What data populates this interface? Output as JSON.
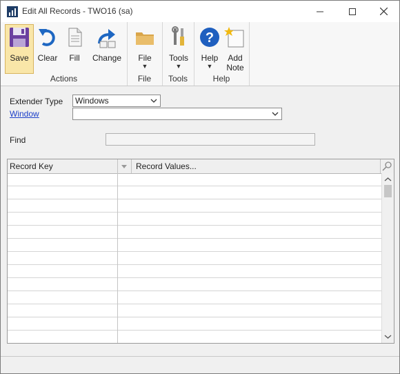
{
  "window": {
    "title": "Edit All Records  -  TWO16 (sa)"
  },
  "ribbon": {
    "groups": {
      "actions": "Actions",
      "file": "File",
      "tools": "Tools",
      "help": "Help"
    },
    "buttons": {
      "save": "Save",
      "clear": "Clear",
      "fill": "Fill",
      "change": "Change",
      "file": "File",
      "tools": "Tools",
      "help": "Help",
      "add_note_1": "Add",
      "add_note_2": "Note"
    }
  },
  "form": {
    "extender_type_label": "Extender Type",
    "extender_type_value": "Windows",
    "window_label": "Window",
    "window_value": "",
    "find_label": "Find",
    "find_value": ""
  },
  "grid": {
    "columns": [
      "Record Key",
      "Record Values..."
    ],
    "row_count": 13
  },
  "colors": {
    "accent_active": "#f9e6a8",
    "link": "#1a3ec9",
    "save_icon": "#6b3fa0",
    "help_icon": "#1f5fbf"
  },
  "icons": [
    "app-icon",
    "minimize-icon",
    "maximize-icon",
    "close-icon",
    "save-icon",
    "clear-icon",
    "fill-icon",
    "change-icon",
    "folder-icon",
    "tools-icon",
    "help-icon",
    "add-note-icon",
    "chevron-down-icon",
    "zoom-icon"
  ]
}
